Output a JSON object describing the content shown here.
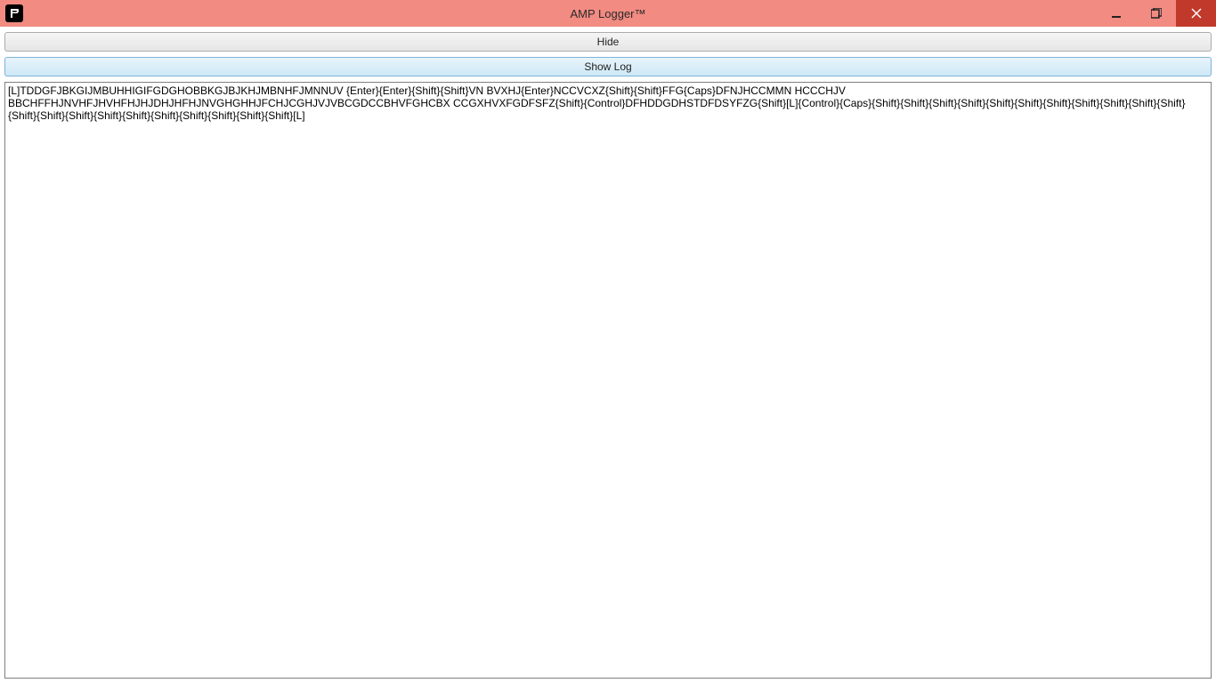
{
  "window": {
    "title": "AMP Logger™"
  },
  "toolbar": {
    "hide_label": "Hide",
    "show_log_label": "Show Log"
  },
  "log": {
    "content": "[L]TDDGFJBKGIJMBUHHIGIFGDGHOBBKGJBJKHJMBNHFJMNNUV {Enter}{Enter}{Shift}{Shift}VN BVXHJ{Enter}NCCVCXZ{Shift}{Shift}FFG{Caps}DFNJHCCMMN  HCCCHJV  BBCHFFHJNVHFJHVHFHJHJDHJHFHJNVGHGHHJFCHJCGHJVJVBCGDCCBHVFGHCBX CCGXHVXFGDFSFZ{Shift}{Control}DFHDDGDHSTDFDSYFZG{Shift}[L]{Control}{Caps}{Shift}{Shift}{Shift}{Shift}{Shift}{Shift}{Shift}{Shift}{Shift}{Shift}{Shift}{Shift}{Shift}{Shift}{Shift}{Shift}{Shift}{Shift}{Shift}{Shift}{Shift}[L]"
  }
}
